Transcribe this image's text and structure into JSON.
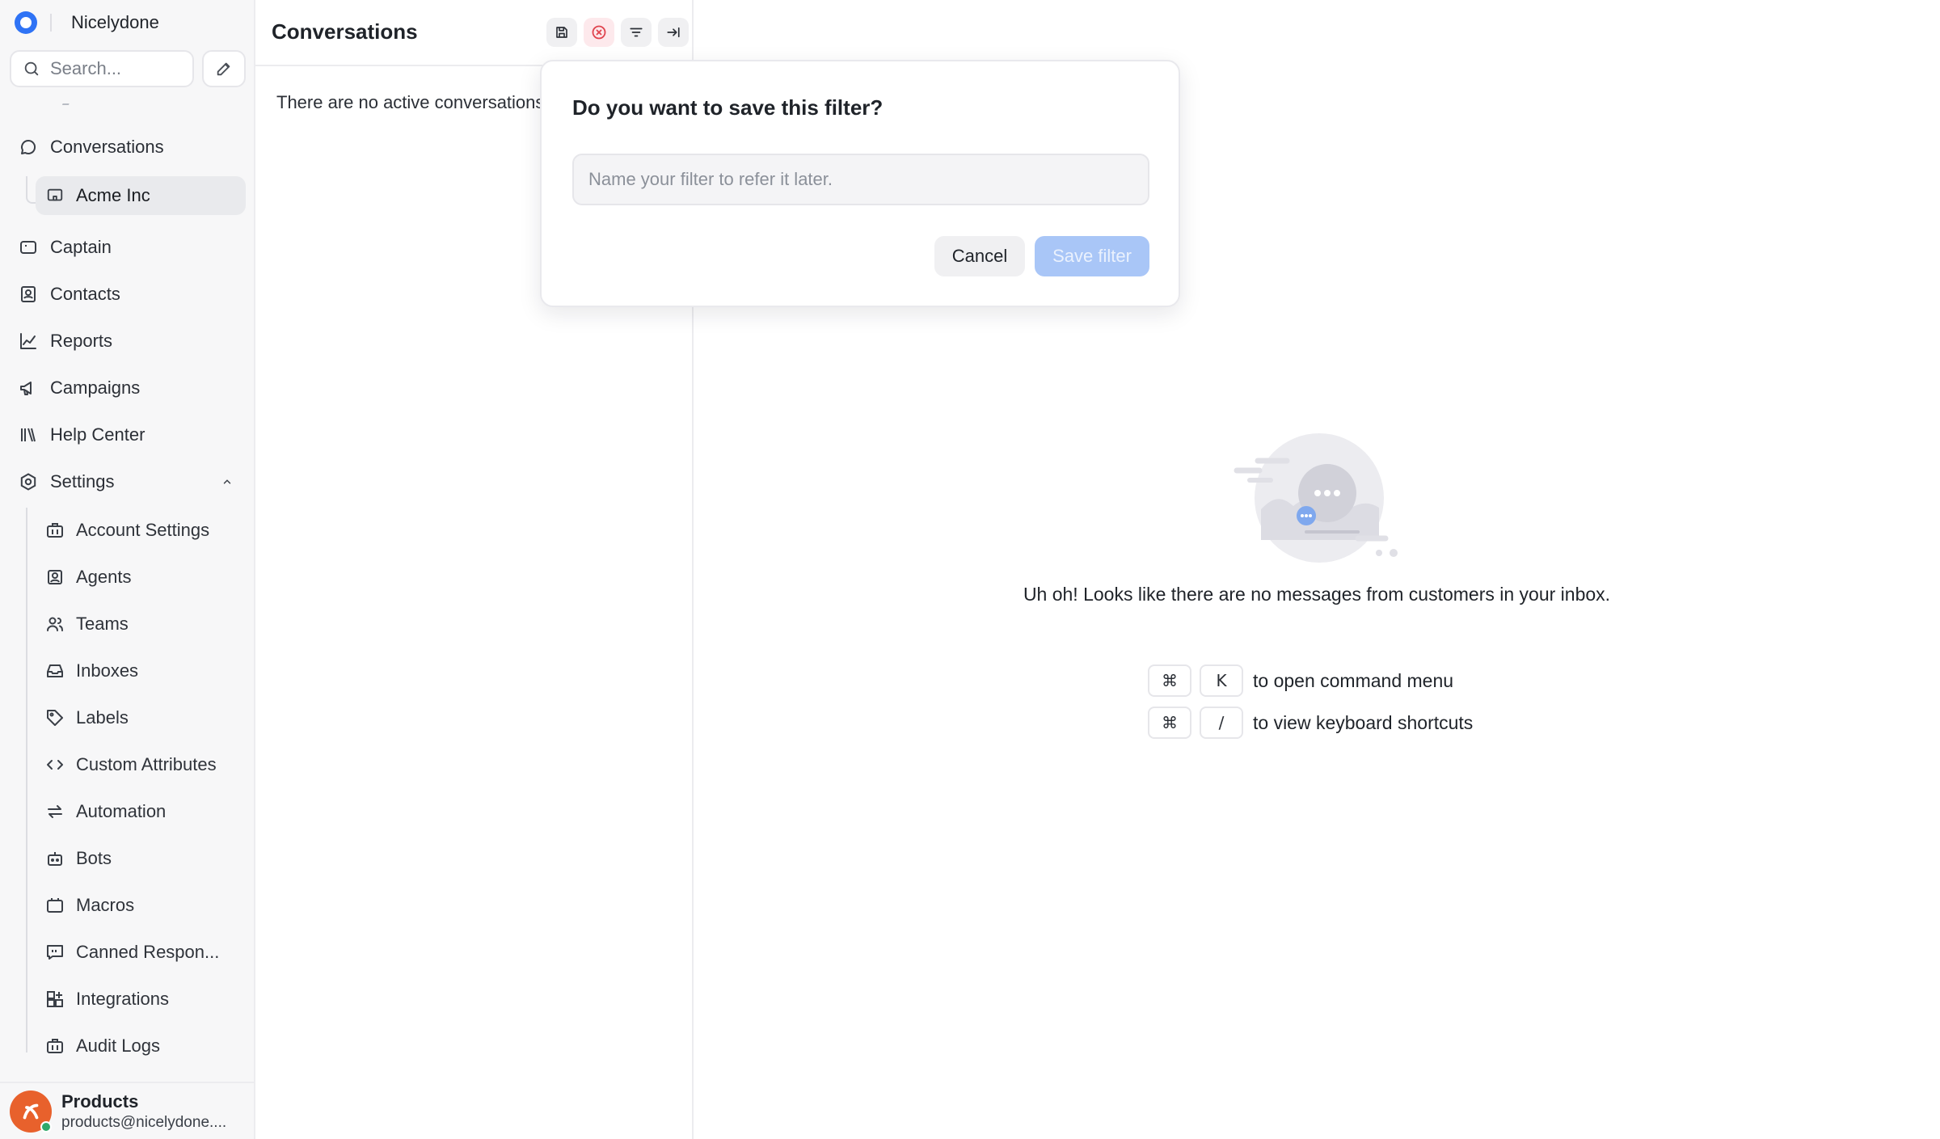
{
  "sidebar": {
    "brand": {
      "name": "Nicelydone",
      "logo_color": "#2f73f5"
    },
    "search": {
      "placeholder": "Search...",
      "icon": "search-icon"
    },
    "compose_icon": "edit-icon",
    "conversations": {
      "label": "Conversations",
      "icon": "chat-bubble-icon"
    },
    "conversation_children": [
      {
        "label": "Acme Inc",
        "icon": "inbox-chat-icon",
        "active": true
      }
    ],
    "items": [
      {
        "label": "Captain",
        "icon": "captain-icon"
      },
      {
        "label": "Contacts",
        "icon": "contact-card-icon"
      },
      {
        "label": "Reports",
        "icon": "chart-line-icon"
      },
      {
        "label": "Campaigns",
        "icon": "megaphone-icon"
      },
      {
        "label": "Help Center",
        "icon": "library-icon"
      }
    ],
    "settings": {
      "label": "Settings",
      "icon": "gear-icon",
      "expanded": true,
      "children": [
        {
          "label": "Account Settings",
          "icon": "briefcase-icon"
        },
        {
          "label": "Agents",
          "icon": "contact-square-icon"
        },
        {
          "label": "Teams",
          "icon": "users-icon"
        },
        {
          "label": "Inboxes",
          "icon": "inbox-tray-icon"
        },
        {
          "label": "Labels",
          "icon": "tag-icon"
        },
        {
          "label": "Custom Attributes",
          "icon": "code-icon"
        },
        {
          "label": "Automation",
          "icon": "arrows-swap-icon"
        },
        {
          "label": "Bots",
          "icon": "bot-icon"
        },
        {
          "label": "Macros",
          "icon": "macro-icon"
        },
        {
          "label": "Canned Respon...",
          "icon": "quote-message-icon"
        },
        {
          "label": "Integrations",
          "icon": "grid-plus-icon"
        },
        {
          "label": "Audit Logs",
          "icon": "briefcase-icon"
        }
      ]
    },
    "profile": {
      "name": "Products",
      "email": "products@nicelydone....",
      "status": "online",
      "avatar_color": "#e8612c"
    }
  },
  "conversations_panel": {
    "title": "Conversations",
    "header_buttons": [
      {
        "name": "save-filter",
        "icon": "save-icon"
      },
      {
        "name": "clear-filter",
        "icon": "close-circle-icon",
        "color": "#e0454f"
      },
      {
        "name": "filter",
        "icon": "filter-icon"
      },
      {
        "name": "collapse",
        "icon": "arrow-right-bar-icon"
      }
    ],
    "empty_message": "There are no active conversations in this group."
  },
  "main": {
    "empty_message": "Uh oh! Looks like there are no messages from customers in your inbox.",
    "shortcuts": [
      {
        "keys": [
          "⌘",
          "K"
        ],
        "text": "to open command menu"
      },
      {
        "keys": [
          "⌘",
          "/"
        ],
        "text": "to view keyboard shortcuts"
      }
    ]
  },
  "modal": {
    "title": "Do you want to save this filter?",
    "input": {
      "placeholder": "Name your filter to refer it later.",
      "value": ""
    },
    "cancel_label": "Cancel",
    "save_label": "Save filter",
    "save_color": "#a9c6f7"
  }
}
